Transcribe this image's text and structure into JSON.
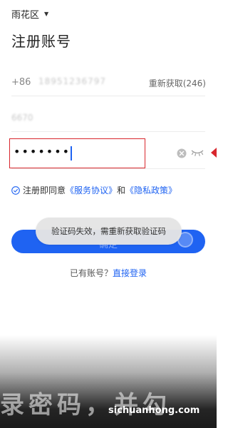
{
  "location": {
    "label": "雨花区"
  },
  "page": {
    "title": "注册账号"
  },
  "phone": {
    "prefix": "+86",
    "number": "18951236797",
    "resend_label": "重新获取(246)"
  },
  "verification": {
    "code_value": "6670"
  },
  "password": {
    "masked_value": "•••••••"
  },
  "agreement": {
    "prefix": "注册即同意",
    "service_link": "《服务协议》",
    "connector": "和",
    "privacy_link": "《隐私政策》"
  },
  "confirm_button": {
    "label": "确定"
  },
  "toast": {
    "message": "验证码失效，需重新获取验证码"
  },
  "login": {
    "prompt": "已有账号？",
    "link": "直接登录"
  },
  "overlay": {
    "caption": "录密码，并勾",
    "watermark": "sichuanhong.com"
  },
  "colors": {
    "accent": "#1f63f2",
    "annotation_red": "#d8262d",
    "toast_bg": "#e4e4e4"
  },
  "icons": [
    "chevron-down-icon",
    "clear-icon",
    "eye-closed-icon",
    "check-circle-icon"
  ]
}
